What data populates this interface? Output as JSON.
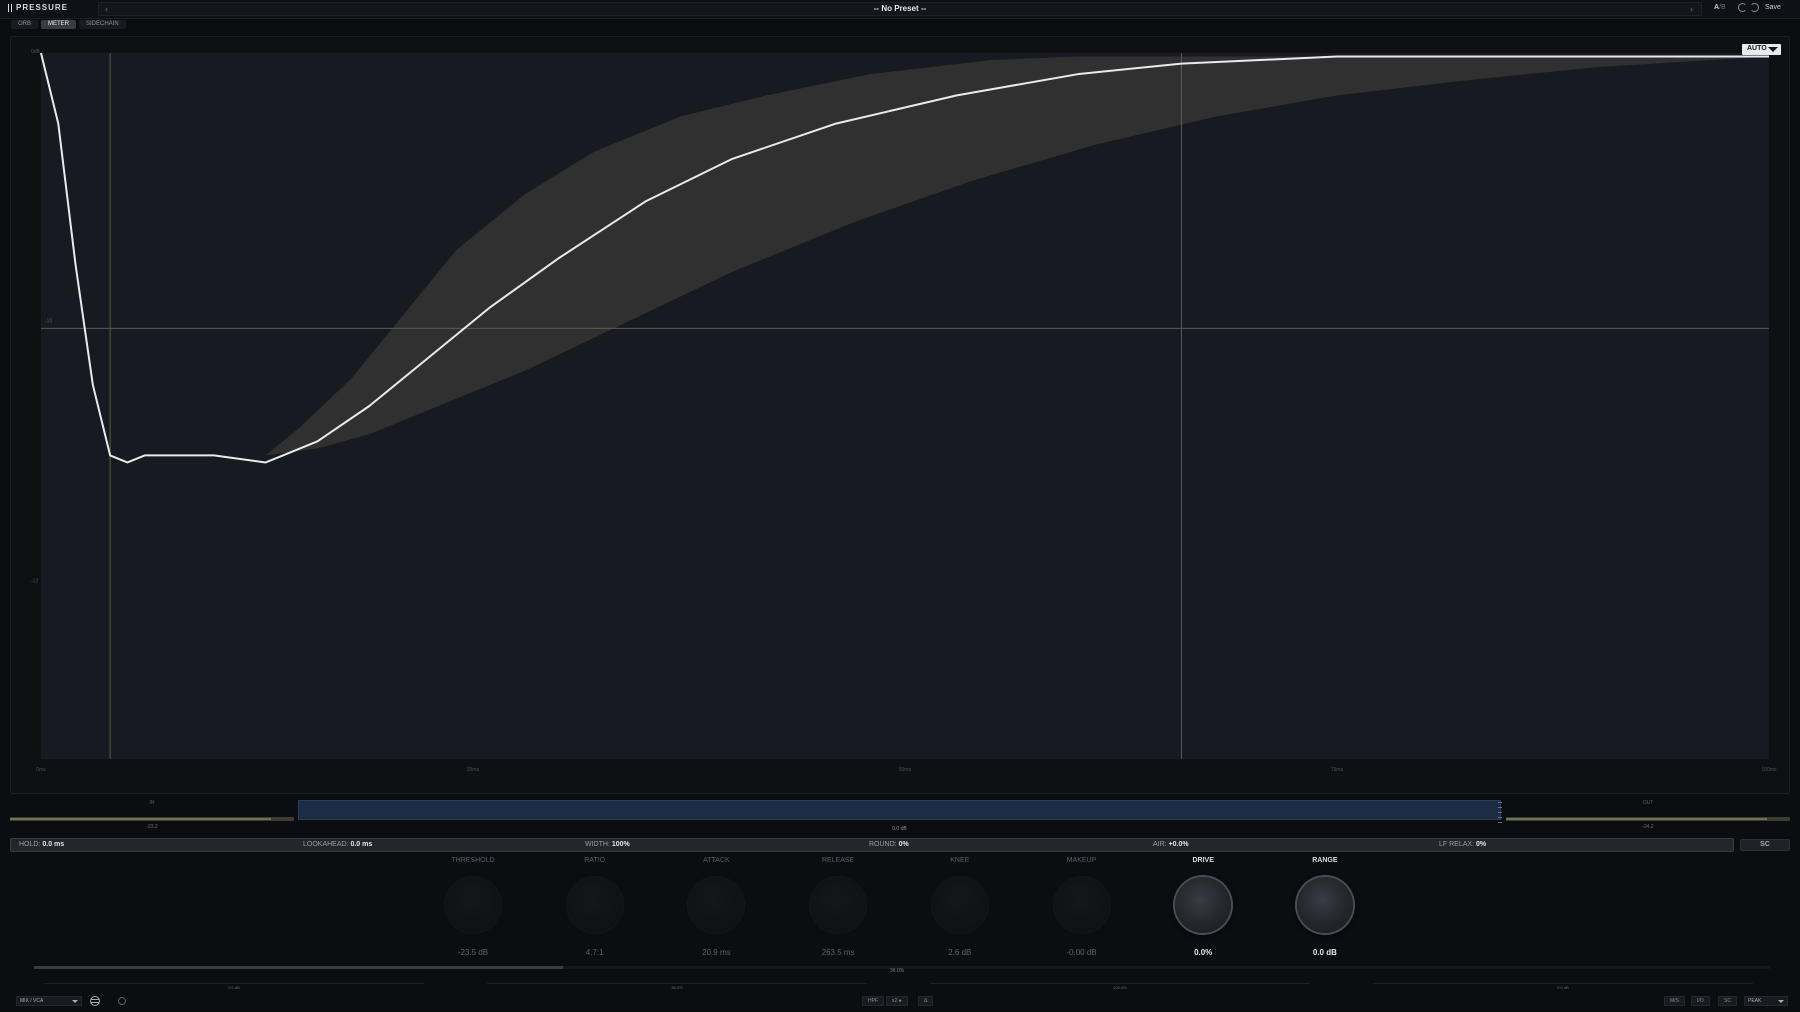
{
  "app": {
    "title": "PRESSURE"
  },
  "preset": {
    "name": "-- No Preset --",
    "prev": "‹",
    "next": "›"
  },
  "header": {
    "ab_active": "A",
    "ab_sep": "/",
    "ab_other": "B",
    "save_label": "Save",
    "undo_icon": "undo-icon",
    "redo_icon": "redo-icon"
  },
  "tabs": [
    {
      "label": "ORB",
      "active": false
    },
    {
      "label": "METER",
      "active": true
    },
    {
      "label": "SIDECHAIN",
      "active": false
    }
  ],
  "graph": {
    "auto_label": "AUTO",
    "colors": {
      "curve": "#e9eaee",
      "band": "#3a3835",
      "grid": "#5a5c4e",
      "bg": "#181a22"
    },
    "curve_points": [
      [
        0,
        0
      ],
      [
        1,
        10
      ],
      [
        2,
        30
      ],
      [
        3,
        47
      ],
      [
        4,
        57
      ],
      [
        5,
        58
      ],
      [
        6,
        57
      ],
      [
        10,
        57
      ],
      [
        13,
        58
      ],
      [
        14,
        57
      ],
      [
        16,
        55
      ],
      [
        19,
        50
      ],
      [
        22,
        44
      ],
      [
        26,
        36
      ],
      [
        30,
        29
      ],
      [
        35,
        21
      ],
      [
        40,
        15
      ],
      [
        46,
        10
      ],
      [
        53,
        6
      ],
      [
        60,
        3
      ],
      [
        66,
        1.5
      ],
      [
        75,
        0.5
      ],
      [
        100,
        0.5
      ]
    ],
    "band_upper": [
      [
        13,
        57
      ],
      [
        15,
        53
      ],
      [
        18,
        46
      ],
      [
        21,
        37
      ],
      [
        24,
        28
      ],
      [
        28,
        20
      ],
      [
        32,
        14
      ],
      [
        37,
        9
      ],
      [
        42,
        6
      ],
      [
        48,
        3
      ],
      [
        55,
        1
      ],
      [
        60,
        0.5
      ],
      [
        100,
        0.5
      ]
    ],
    "band_lower": [
      [
        13,
        57
      ],
      [
        16,
        56
      ],
      [
        19,
        54
      ],
      [
        23,
        50
      ],
      [
        28,
        45
      ],
      [
        34,
        38
      ],
      [
        40,
        31
      ],
      [
        47,
        24
      ],
      [
        54,
        18
      ],
      [
        61,
        13
      ],
      [
        68,
        9
      ],
      [
        75,
        6
      ],
      [
        82,
        4
      ],
      [
        90,
        2
      ],
      [
        100,
        0.5
      ]
    ],
    "crosshair": {
      "x1": 4,
      "x2": 66,
      "y": 39
    },
    "x_ticks": [
      "0ms",
      "25ms",
      "50ms",
      "75ms",
      "100ms"
    ],
    "y_ticks": [
      "0dB",
      "",
      "",
      "-12",
      "",
      "",
      ""
    ],
    "y_marker": "-10"
  },
  "meters": {
    "in": {
      "label": "IN",
      "value": "-23.2",
      "level": 0.92
    },
    "out": {
      "label": "OUT",
      "value": "-24.2",
      "level": 0.92
    },
    "gr": {
      "value": "0.0 dB"
    }
  },
  "params": [
    {
      "label": "HOLD:",
      "value": "0.0 ms"
    },
    {
      "label": "LOOKAHEAD:",
      "value": "0.0 ms"
    },
    {
      "label": "WIDTH:",
      "value": "100%"
    },
    {
      "label": "ROUND:",
      "value": "0%"
    },
    {
      "label": "AIR:",
      "value": "+0.0%"
    },
    {
      "label": "LF RELAX:",
      "value": "0%"
    }
  ],
  "sc_label": "SC",
  "knobs": [
    {
      "name": "THRESHOLD",
      "value": "-23.5 dB",
      "bright": false
    },
    {
      "name": "RATIO",
      "value": "4.7:1",
      "bright": false
    },
    {
      "name": "ATTACK",
      "value": "20.9 ms",
      "bright": false
    },
    {
      "name": "RELEASE",
      "value": "263.5 ms",
      "bright": false
    },
    {
      "name": "KNEE",
      "value": "2.6 dB",
      "bright": false
    },
    {
      "name": "MAKEUP",
      "value": "-0.00 dB",
      "bright": false
    },
    {
      "name": "DRIVE",
      "value": "0.0%",
      "bright": true
    },
    {
      "name": "RANGE",
      "value": "0.0 dB",
      "bright": true
    }
  ],
  "mix": {
    "value": "36.0%",
    "level": 0.305
  },
  "sub_sliders": [
    {
      "value": "0.0 dB"
    },
    {
      "value": "36.0%"
    },
    {
      "value": "100.0%"
    },
    {
      "value": "0.0 dB"
    }
  ],
  "footer": {
    "mode": "MIX / VCA",
    "globe_icon": "globe-icon",
    "power_icon": "power-icon",
    "center_buttons": [
      "HPF",
      "x2 ●",
      "Δ"
    ],
    "right_buttons": [
      "M/S",
      "I/O",
      "SC"
    ],
    "right_select": "PEAK"
  }
}
